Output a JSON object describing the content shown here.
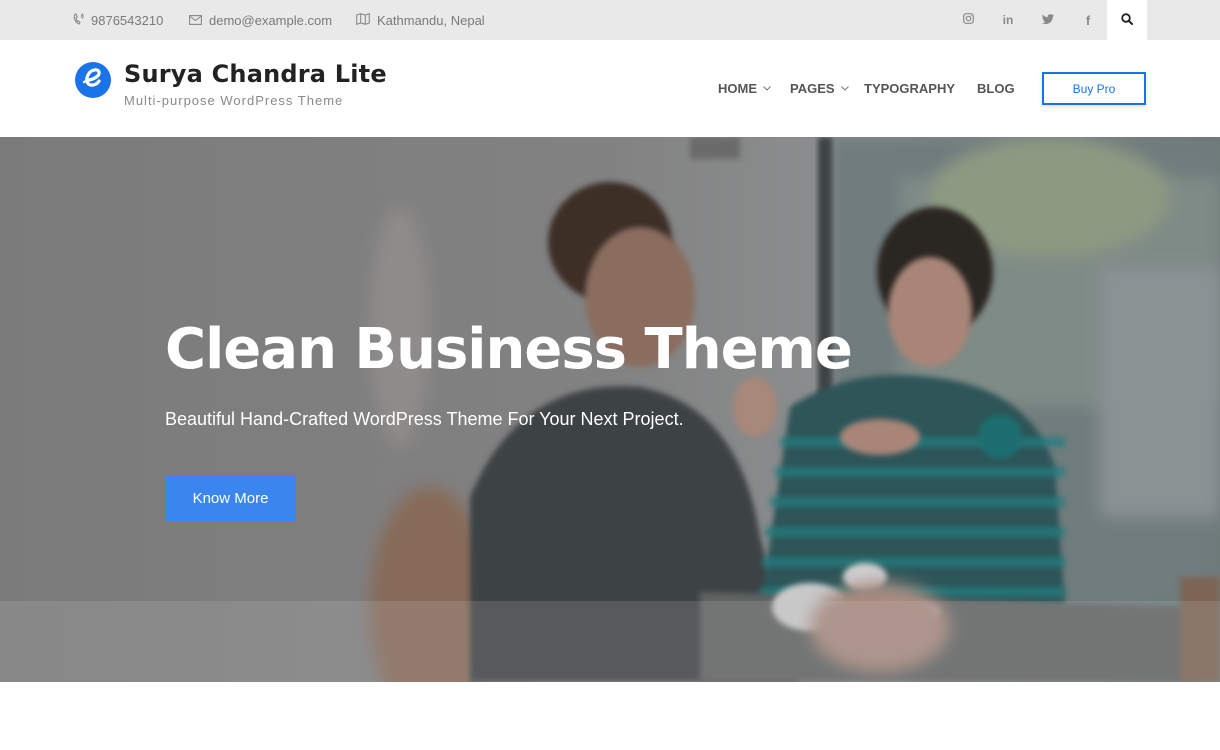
{
  "topbar": {
    "phone": {
      "icon": "phone-icon",
      "text": "9876543210"
    },
    "email": {
      "icon": "envelope-icon",
      "text": "demo@example.com"
    },
    "location": {
      "icon": "map-icon",
      "text": "Kathmandu, Nepal"
    },
    "social": [
      {
        "name": "instagram",
        "icon": "instagram-icon",
        "glyph": "◎"
      },
      {
        "name": "linkedin",
        "icon": "linkedin-icon",
        "glyph": "in"
      },
      {
        "name": "twitter",
        "icon": "twitter-icon",
        "glyph": "🐦"
      },
      {
        "name": "facebook",
        "icon": "facebook-icon",
        "glyph": "f"
      }
    ],
    "search_icon": "search-icon"
  },
  "header": {
    "site_title": "Surya Chandra Lite",
    "tagline": "Multi-purpose WordPress Theme",
    "logo_letter": "e",
    "nav": [
      {
        "label": "HOME",
        "has_dropdown": true
      },
      {
        "label": "PAGES",
        "has_dropdown": true
      },
      {
        "label": "TYPOGRAPHY",
        "has_dropdown": false
      },
      {
        "label": "BLOG",
        "has_dropdown": false
      }
    ],
    "buy_pro_label": "Buy Pro"
  },
  "hero": {
    "title": "Clean Business Theme",
    "subtitle": "Beautiful Hand-Crafted WordPress Theme For Your Next Project.",
    "button_label": "Know More"
  },
  "colors": {
    "accent": "#1a73e8",
    "hero_button": "#3b86ee",
    "topbar_bg": "#e9e9e9"
  }
}
